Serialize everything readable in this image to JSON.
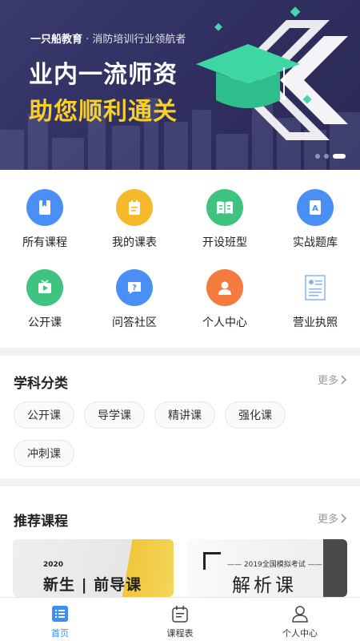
{
  "banner": {
    "brand": "一只船教育",
    "slogan": "· 消防培训行业领航者",
    "line1": "业内一流师资",
    "line2": "助您顺利通关",
    "active_slide": 3,
    "slide_count": 3
  },
  "grid": [
    {
      "label": "所有课程",
      "icon": "book-icon",
      "color": "#4a8ff5"
    },
    {
      "label": "我的课表",
      "icon": "notepad-icon",
      "color": "#f6b92b"
    },
    {
      "label": "开设班型",
      "icon": "open-book-icon",
      "color": "#3fc380"
    },
    {
      "label": "实战题库",
      "icon": "question-bank-icon",
      "color": "#4a8ff5"
    },
    {
      "label": "公开课",
      "icon": "tv-play-icon",
      "color": "#3fc380"
    },
    {
      "label": "问答社区",
      "icon": "question-bubble-icon",
      "color": "#4a8ff5"
    },
    {
      "label": "个人中心",
      "icon": "person-icon",
      "color": "#f47a3d"
    },
    {
      "label": "营业执照",
      "icon": "license-icon",
      "color": "#ffffff"
    }
  ],
  "subjects": {
    "title": "学科分类",
    "more": "更多",
    "chips": [
      "公开课",
      "导学课",
      "精讲课",
      "强化课",
      "冲刺课"
    ]
  },
  "recommend": {
    "title": "推荐课程",
    "more": "更多",
    "courses": [
      {
        "year": "2020",
        "title": "新生 | 前导课"
      },
      {
        "subtitle": "—— 2019全国模拟考试 ——",
        "title": "解析课"
      }
    ]
  },
  "tabbar": {
    "tabs": [
      {
        "label": "首页",
        "icon": "home-list-icon"
      },
      {
        "label": "课程表",
        "icon": "schedule-icon"
      },
      {
        "label": "个人中心",
        "icon": "user-icon"
      }
    ],
    "active_tab": "首页",
    "accent": "#3e8ef7"
  }
}
